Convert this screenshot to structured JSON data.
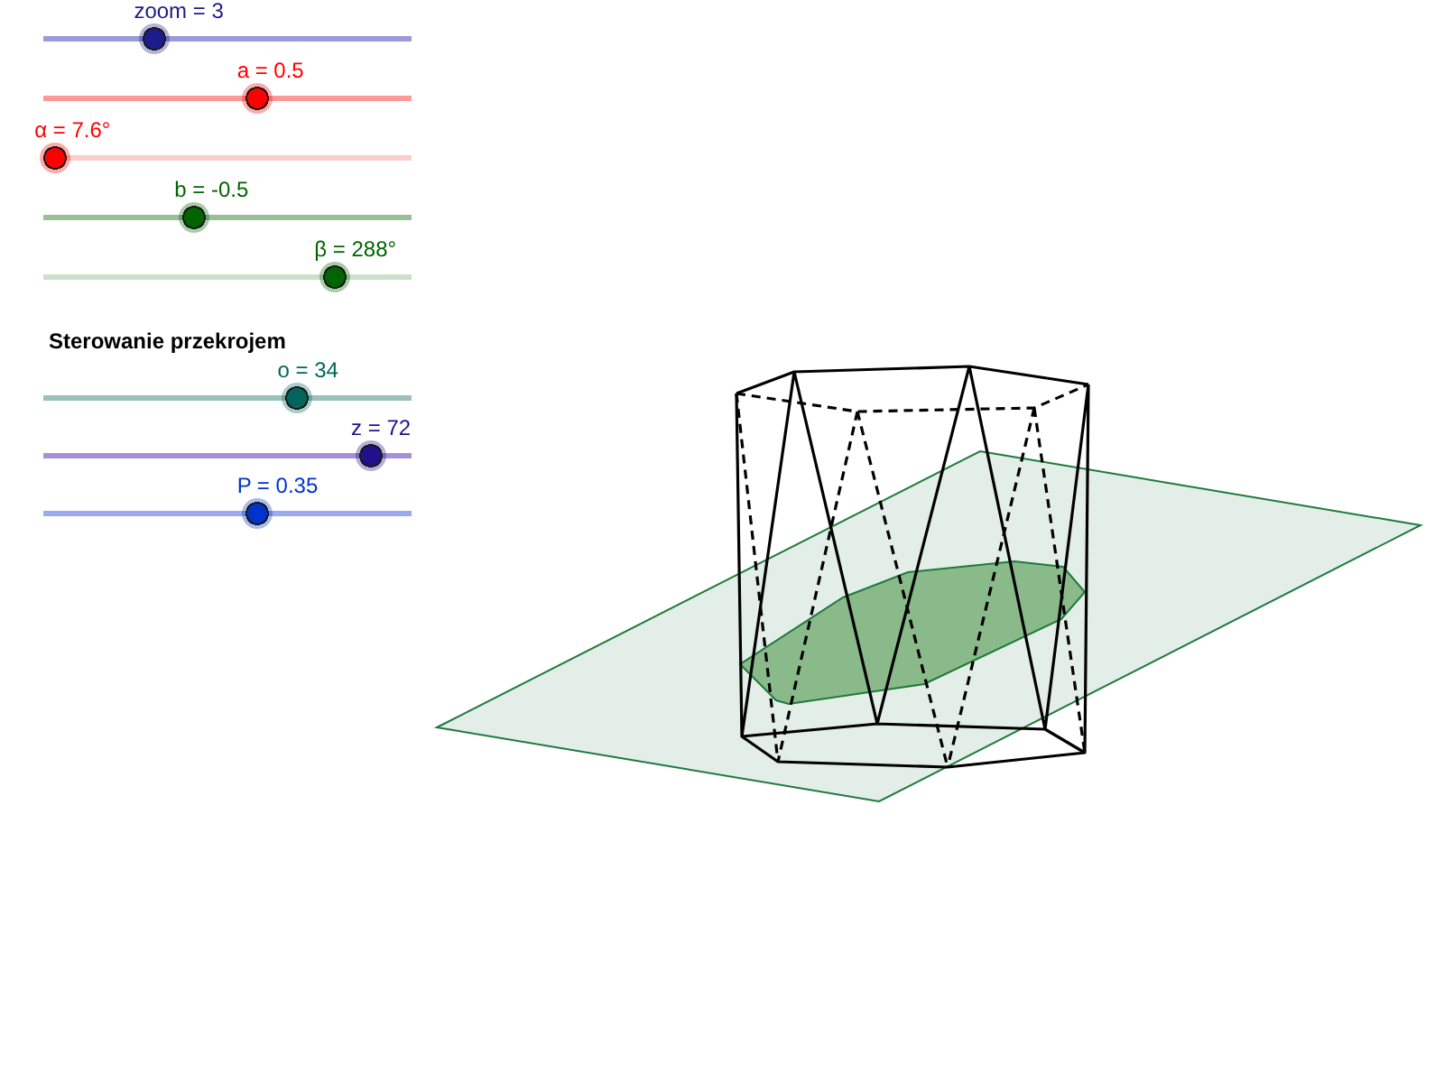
{
  "sliders": [
    {
      "label": "zoom = 3",
      "color": "#1c1c8c",
      "track": {
        "color": "#9a9ad8"
      },
      "level": 0.3
    },
    {
      "label": "a = 0.5",
      "color": "#ff0000",
      "track": {
        "color": "#ff9999"
      },
      "level": 0.58
    },
    {
      "label": "α = 7.6°",
      "color": "#ff0000",
      "track": {
        "color": "#ffcccc"
      },
      "level": 0.03
    },
    {
      "label": "b = -0.5",
      "color": "#006400",
      "track": {
        "color": "#99bf99"
      },
      "level": 0.41
    },
    {
      "label": "β = 288°",
      "color": "#006400",
      "track": {
        "color": "#cce0cc"
      },
      "level": 0.79
    }
  ],
  "section_control": {
    "heading": "Sterowanie przekrojem",
    "sliders": [
      {
        "label": "o = 34",
        "color": "#00665c",
        "track": {
          "color": "#99c2bb"
        },
        "level": 0.69
      },
      {
        "label": "z = 72",
        "color": "#20108a",
        "track": {
          "color": "#a591d8"
        },
        "level": 0.89
      },
      {
        "label": "P = 0.35",
        "color": "#0033cc",
        "track": {
          "color": "#99aaee"
        },
        "level": 0.58
      }
    ]
  }
}
